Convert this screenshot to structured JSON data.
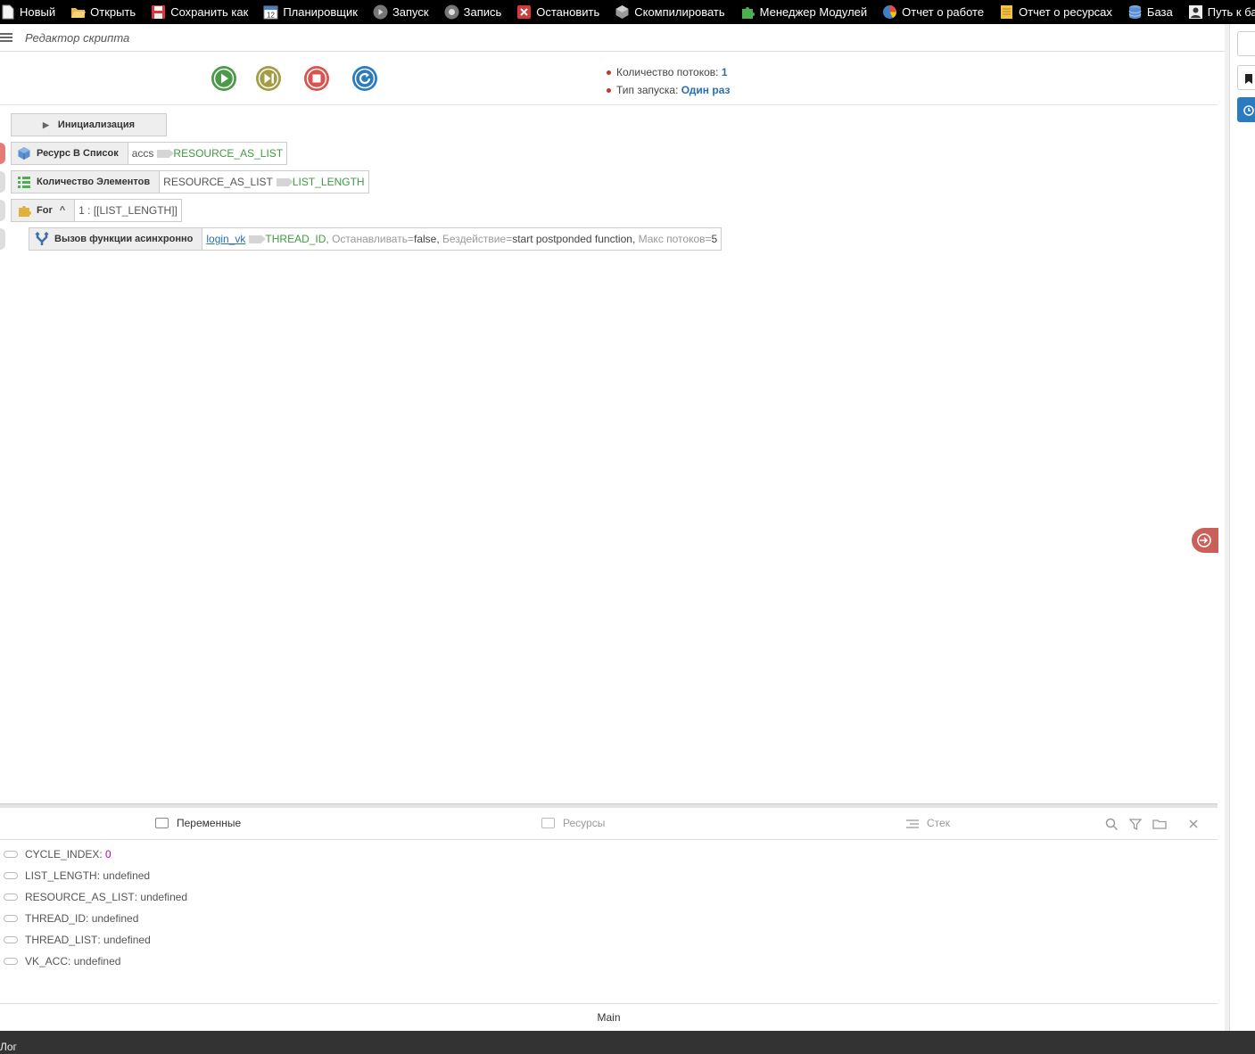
{
  "toolbar": {
    "items": [
      {
        "label": "Новый",
        "icon": "new-file-icon"
      },
      {
        "label": "Открыть",
        "icon": "folder-open-icon"
      },
      {
        "label": "Сохранить как",
        "icon": "save-icon"
      },
      {
        "label": "Планировщик",
        "icon": "calendar-icon"
      },
      {
        "label": "Запуск",
        "icon": "play-icon"
      },
      {
        "label": "Запись",
        "icon": "record-icon"
      },
      {
        "label": "Остановить",
        "icon": "stop-icon"
      },
      {
        "label": "Скомпилировать",
        "icon": "compile-icon"
      },
      {
        "label": "Менеджер Модулей",
        "icon": "puzzle-icon"
      },
      {
        "label": "Отчет о работе",
        "icon": "pie-chart-icon"
      },
      {
        "label": "Отчет о ресурсах",
        "icon": "notes-icon"
      },
      {
        "label": "База",
        "icon": "database-icon"
      },
      {
        "label": "Путь к ба",
        "icon": "user-icon"
      }
    ]
  },
  "editor": {
    "title": "Редактор скрипта"
  },
  "info": {
    "threads_label": "Количество потоков:",
    "threads_value": "1",
    "launch_label": "Тип запуска:",
    "launch_value": "Один раз"
  },
  "script": {
    "init_label": "Инициализация",
    "blocks": [
      {
        "name": "Ресурс В Список",
        "arg": "accs",
        "result": "RESOURCE_AS_LIST"
      },
      {
        "name": "Количество Элементов",
        "arg": "RESOURCE_AS_LIST",
        "result": "LIST_LENGTH"
      },
      {
        "name": "For",
        "arg": "1 : [[LIST_LENGTH]]"
      },
      {
        "name": "Вызов функции асинхронно",
        "func": "login_vk",
        "result": "THREAD_ID,",
        "p1_key": "Останавливать=",
        "p1_val": "false,",
        "p2_key": "Бездействие=",
        "p2_val": "start postponded function,",
        "p3_key": "Макс потоков=",
        "p3_val": "5"
      }
    ]
  },
  "panel": {
    "tabs": [
      "Переменные",
      "Ресурсы",
      "Стек"
    ],
    "variables": [
      {
        "name": "CYCLE_INDEX",
        "value": "0",
        "numeric": true
      },
      {
        "name": "LIST_LENGTH",
        "value": "undefined"
      },
      {
        "name": "RESOURCE_AS_LIST",
        "value": "undefined"
      },
      {
        "name": "THREAD_ID",
        "value": "undefined"
      },
      {
        "name": "THREAD_LIST",
        "value": "undefined"
      },
      {
        "name": "VK_ACC",
        "value": "undefined"
      }
    ]
  },
  "status": {
    "main": "Main",
    "log": "Лог"
  },
  "colors": {
    "play": "#4a9a4a",
    "step": "#a39b45",
    "stop": "#d9534f",
    "restart": "#2a7bbf",
    "accent": "#2a6fb0"
  }
}
